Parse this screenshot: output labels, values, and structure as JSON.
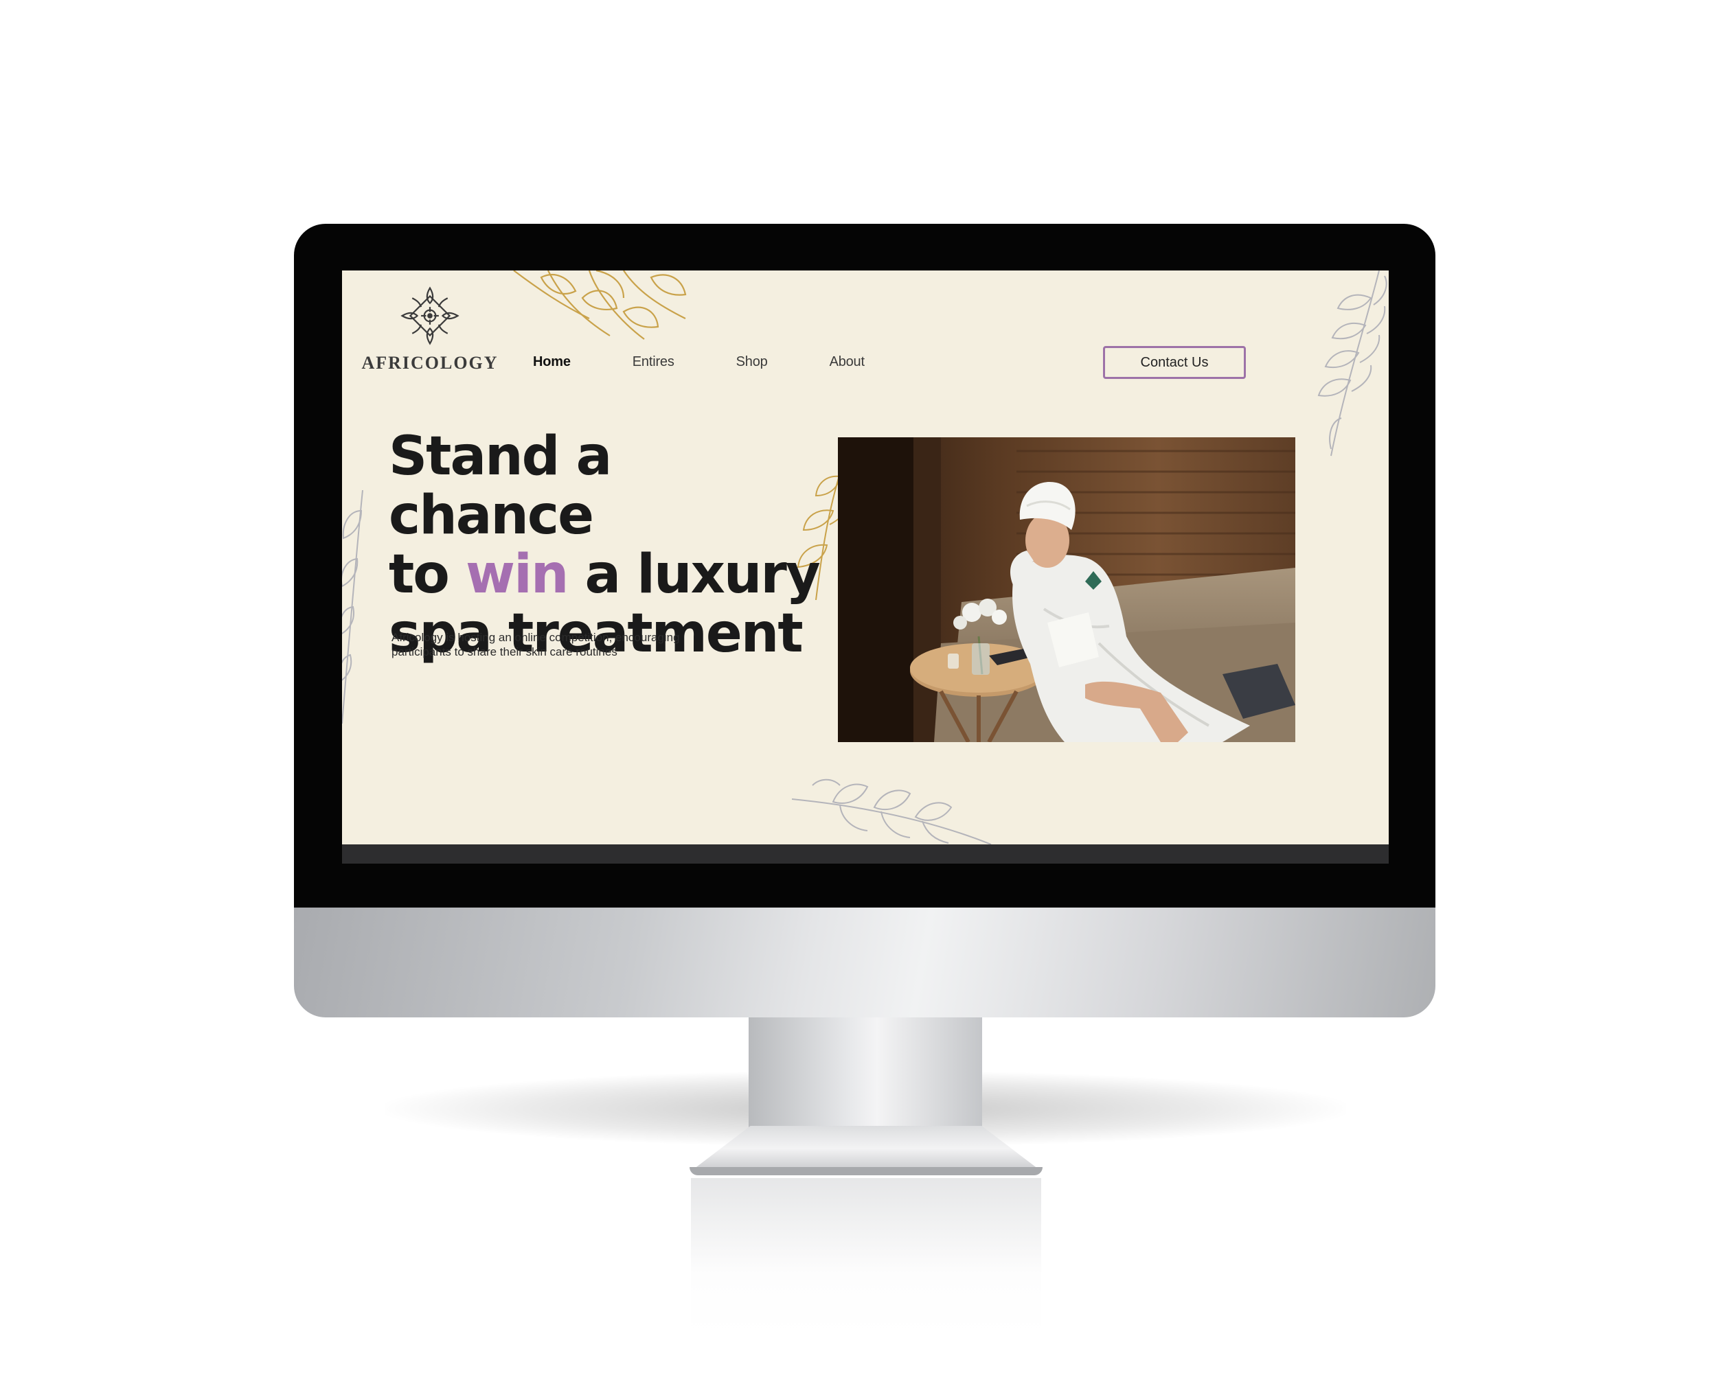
{
  "brand": {
    "name": "AFRICOLOGY",
    "logo_icon": "ornament-logo-icon"
  },
  "nav": {
    "items": [
      {
        "label": "Home",
        "active": true
      },
      {
        "label": "Entires",
        "active": false
      },
      {
        "label": "Shop",
        "active": false
      },
      {
        "label": "About",
        "active": false
      }
    ]
  },
  "header": {
    "contact_label": "Contact Us"
  },
  "hero": {
    "headline_line1": "Stand a chance",
    "headline_line2_pre": "to ",
    "headline_accent": "win",
    "headline_line2_post": " a luxury",
    "headline_line3": "spa treatment",
    "description": "Africology is hosting an online competition, encouraging participants to share their skin care routines",
    "image_icon": "spa-woman-photo"
  },
  "colors": {
    "background": "#f4efe0",
    "accent": "#a56fb1",
    "button_border": "#9d72a8",
    "text": "#1a1a1a",
    "gold_leaf": "#c9a24a",
    "grey_leaf": "#b4b4ba"
  }
}
